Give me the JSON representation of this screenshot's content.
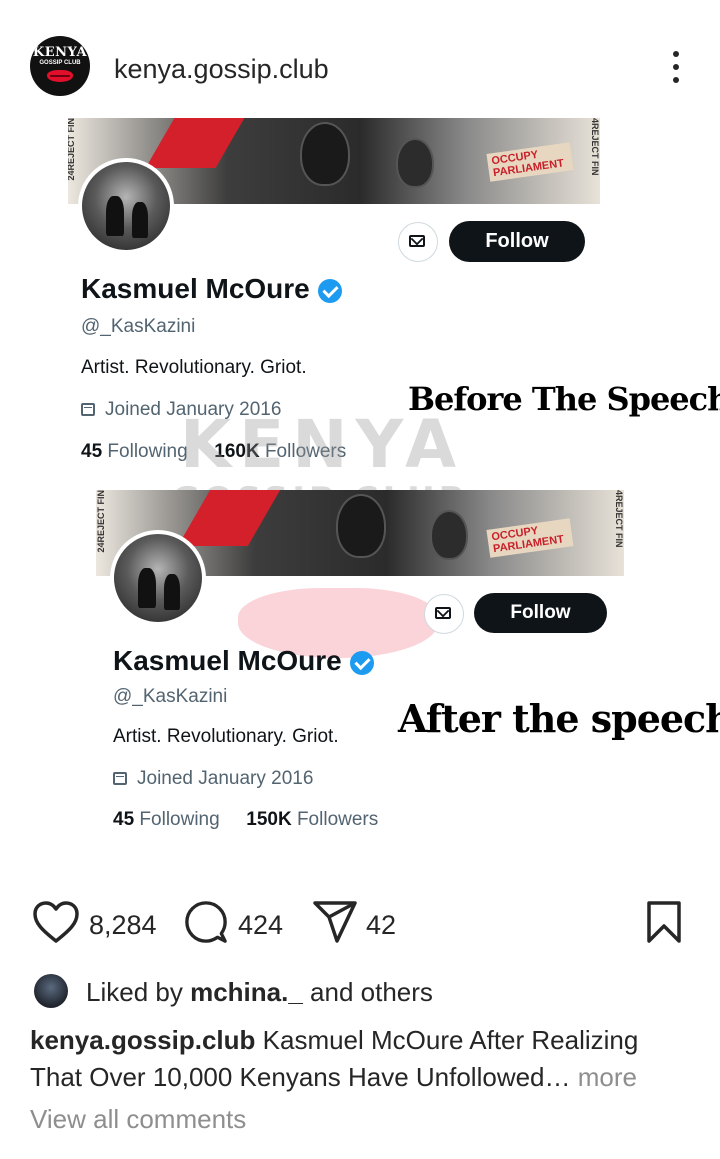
{
  "header": {
    "logo_line1": "KENYA",
    "logo_line2": "GOSSIP CLUB",
    "username": "kenya.gossip.club",
    "more_icon": "more-vertical-icon"
  },
  "post": {
    "watermark_line1": "KENYA",
    "watermark_line2": "GOSSIP CLUB",
    "before": {
      "banner_side_left": "24REJECT FIN",
      "banner_side_right": "4REJECT FIN",
      "banner_poster": "OCCUPY PARLIAMENT",
      "follow_label": "Follow",
      "name": "Kasmuel McOure",
      "handle": "@_KasKazini",
      "bio": "Artist. Revolutionary. Griot.",
      "joined": "Joined January 2016",
      "following_count": "45",
      "following_label": "Following",
      "followers_count": "160K",
      "followers_label": "Followers",
      "overlay_label": "Before The Speech"
    },
    "after": {
      "banner_side_left": "24REJECT FIN",
      "banner_side_right": "4REJECT FIN",
      "banner_poster": "OCCUPY PARLIAMENT",
      "follow_label": "Follow",
      "name": "Kasmuel McOure",
      "handle": "@_KasKazini",
      "bio": "Artist. Revolutionary. Griot.",
      "joined": "Joined January 2016",
      "following_count": "45",
      "following_label": "Following",
      "followers_count": "150K",
      "followers_label": "Followers",
      "overlay_label": "After the speech"
    },
    "carousel": {
      "total": 3,
      "active": 2
    }
  },
  "actions": {
    "likes": "8,284",
    "comments": "424",
    "shares": "42"
  },
  "liked_by": {
    "prefix": "Liked by",
    "user": "mchina._",
    "suffix": "and others"
  },
  "caption": {
    "username": "kenya.gossip.club",
    "text": "Kasmuel McOure After Realizing That Over 10,000 Kenyans Have Unfollowed…",
    "more": "more"
  },
  "view_comments": "View all comments",
  "colors": {
    "accent": "#0095f6",
    "verified": "#1d9bf0",
    "follow_bg": "#0f1419",
    "text": "#262626",
    "muted": "#8e8e8e"
  }
}
